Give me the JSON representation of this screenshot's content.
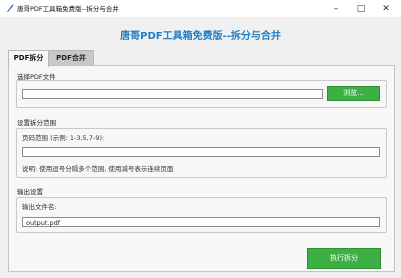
{
  "window": {
    "title": "唐哥PDF工具箱免费版--拆分与合并"
  },
  "header": {
    "title": "唐哥PDF工具箱免费版--拆分与合并"
  },
  "tabs": [
    {
      "label": "PDF拆分"
    },
    {
      "label": "PDF合并"
    }
  ],
  "select_file": {
    "section_label": "选择PDF文件",
    "path_value": "",
    "browse_label": "浏览..."
  },
  "range": {
    "section_label": "设置拆分范围",
    "field_label": "页码范围 (示例: 1-3,5,7-9):",
    "value": "",
    "note": "说明: 使用逗号分隔多个范围, 使用减号表示连续页面"
  },
  "output": {
    "section_label": "输出设置",
    "field_label": "输出文件名:",
    "value": "output.pdf"
  },
  "actions": {
    "run_label": "执行拆分"
  },
  "colors": {
    "accent": "#1e7fc6",
    "button_green": "#3cb043"
  }
}
